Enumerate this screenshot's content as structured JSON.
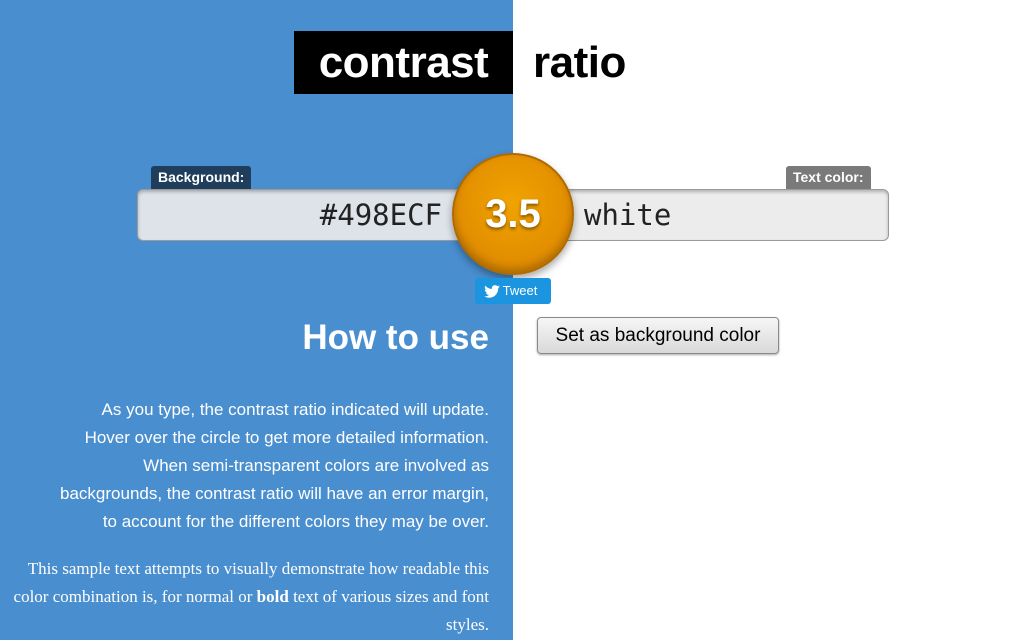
{
  "header": {
    "title_left": "contrast",
    "title_right": "ratio"
  },
  "background": {
    "label": "Background:",
    "value": "#498ECF",
    "color": "#498ECF"
  },
  "text_color": {
    "label": "Text color:",
    "value": "white",
    "color": "#ffffff"
  },
  "ratio": {
    "value": "3.5",
    "color": "#e69500"
  },
  "tweet": {
    "label": "Tweet",
    "icon": "twitter-bird-icon"
  },
  "actions": {
    "set_background_label": "Set as background color"
  },
  "how_to_use": {
    "title": "How to use",
    "lines": [
      "As you type, the contrast ratio indicated will update.",
      "Hover over the circle to get more detailed information.",
      "When semi-transparent colors are involved as",
      "backgrounds, the contrast ratio will have an error margin,",
      "to account for the different colors they may be over."
    ]
  },
  "sample": {
    "part1": "This sample text attempts to visually demonstrate how readable this color combination is, for normal or ",
    "bold": "bold",
    "part2": " text of various sizes and font styles."
  }
}
